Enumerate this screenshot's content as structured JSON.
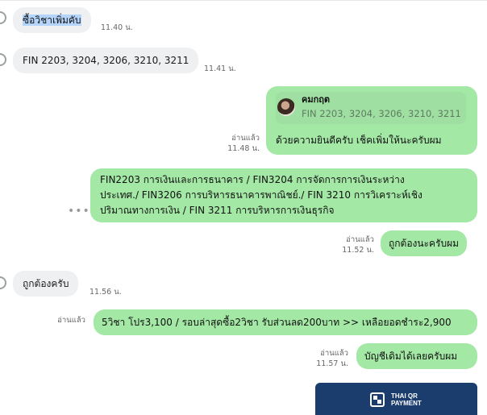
{
  "messages": {
    "m1": {
      "text": "ซื้อวิชาเพิ่มคับ",
      "time": "11.40 น."
    },
    "m2": {
      "text": "FIN 2203, 3204, 3206, 3210, 3211",
      "time": "11.41 น."
    },
    "m3": {
      "reply_name": "คมกฤต",
      "reply_quote": "FIN 2203, 3204, 3206, 3210, 3211",
      "text": "ด้วยความยินดีครับ เช็คเพิ่มให้นะครับผม",
      "read": "อ่านแล้ว",
      "time": "11.48 น."
    },
    "m4": {
      "line1": "FIN2203 การเงินและการธนาคาร / FIN3204 การจัดการการเงินระหว่าง",
      "line2": "ประเทศ./ FIN3206 การบริหารธนาคารพาณิชย์./ FIN 3210 การวิเคราะห์เชิง",
      "line3": "ปริมาณทางการเงิน / FIN 3211 การบริหารการเงินธุรกิจ",
      "more": "•••"
    },
    "m5": {
      "text": "ถูกต้องนะครับผม",
      "read": "อ่านแล้ว",
      "time": "11.52 น."
    },
    "m6": {
      "text": "ถูกต้องครับ",
      "time": "11.56 น."
    },
    "m7": {
      "text": "5วิชา โปร3,100 / รอบล่าสุดซื้อ2วิชา รับส่วนลด200บาท >> เหลือยอดชำระ2,900",
      "read": "อ่านแล้ว"
    },
    "m8": {
      "text": "บัญชีเดิมได้เลยครับผม",
      "read": "อ่านแล้ว",
      "time": "11.57 น."
    }
  },
  "qr_card": {
    "label": "THAI QR\nPAYMENT",
    "icon": "qr-icon",
    "color": "#1b3d6e"
  },
  "colors": {
    "outgoing": "#a4e8a6",
    "incoming": "#eef0f2",
    "selection": "#b4d4fb"
  }
}
